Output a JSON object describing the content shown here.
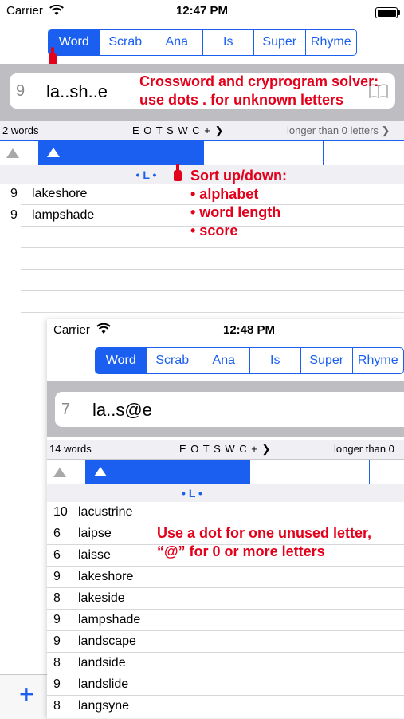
{
  "status1": {
    "carrier": "Carrier",
    "time": "12:47 PM"
  },
  "tabs1": [
    "Word",
    "Scrab",
    "Ana",
    "Is",
    "Super",
    "Rhyme"
  ],
  "search1": {
    "length": "9",
    "query": "la..sh..e"
  },
  "info1": {
    "count": "2 words",
    "letters": "E O T S W C + ❯",
    "filter": "longer than 0 letters ❯"
  },
  "group1": "• L •",
  "results1": [
    {
      "n": "9",
      "word": "lakeshore"
    },
    {
      "n": "9",
      "word": "lampshade"
    }
  ],
  "annot_search": [
    "Crossword and cryprogram solver:",
    "use dots . for unknown letters"
  ],
  "annot_sort": {
    "title": "Sort up/down:",
    "items": [
      "• alphabet",
      "• word length",
      "• score"
    ]
  },
  "status2": {
    "carrier": "Carrier",
    "time": "12:48 PM"
  },
  "tabs2": [
    "Word",
    "Scrab",
    "Ana",
    "Is",
    "Super",
    "Rhyme"
  ],
  "search2": {
    "length": "7",
    "query": "la..s@e"
  },
  "info2": {
    "count": "14 words",
    "letters": "E O T S W C + ❯",
    "filter": "longer than 0"
  },
  "group2": "• L •",
  "results2": [
    {
      "n": "10",
      "word": "lacustrine"
    },
    {
      "n": "6",
      "word": "laipse"
    },
    {
      "n": "6",
      "word": "laisse"
    },
    {
      "n": "9",
      "word": "lakeshore"
    },
    {
      "n": "8",
      "word": "lakeside"
    },
    {
      "n": "9",
      "word": "lampshade"
    },
    {
      "n": "9",
      "word": "landscape"
    },
    {
      "n": "8",
      "word": "landside"
    },
    {
      "n": "9",
      "word": "landslide"
    },
    {
      "n": "8",
      "word": "langsyne"
    }
  ],
  "annot_dot": [
    "Use a dot for one unused letter,",
    "“@” for 0 or more letters"
  ],
  "plus_label": "+"
}
